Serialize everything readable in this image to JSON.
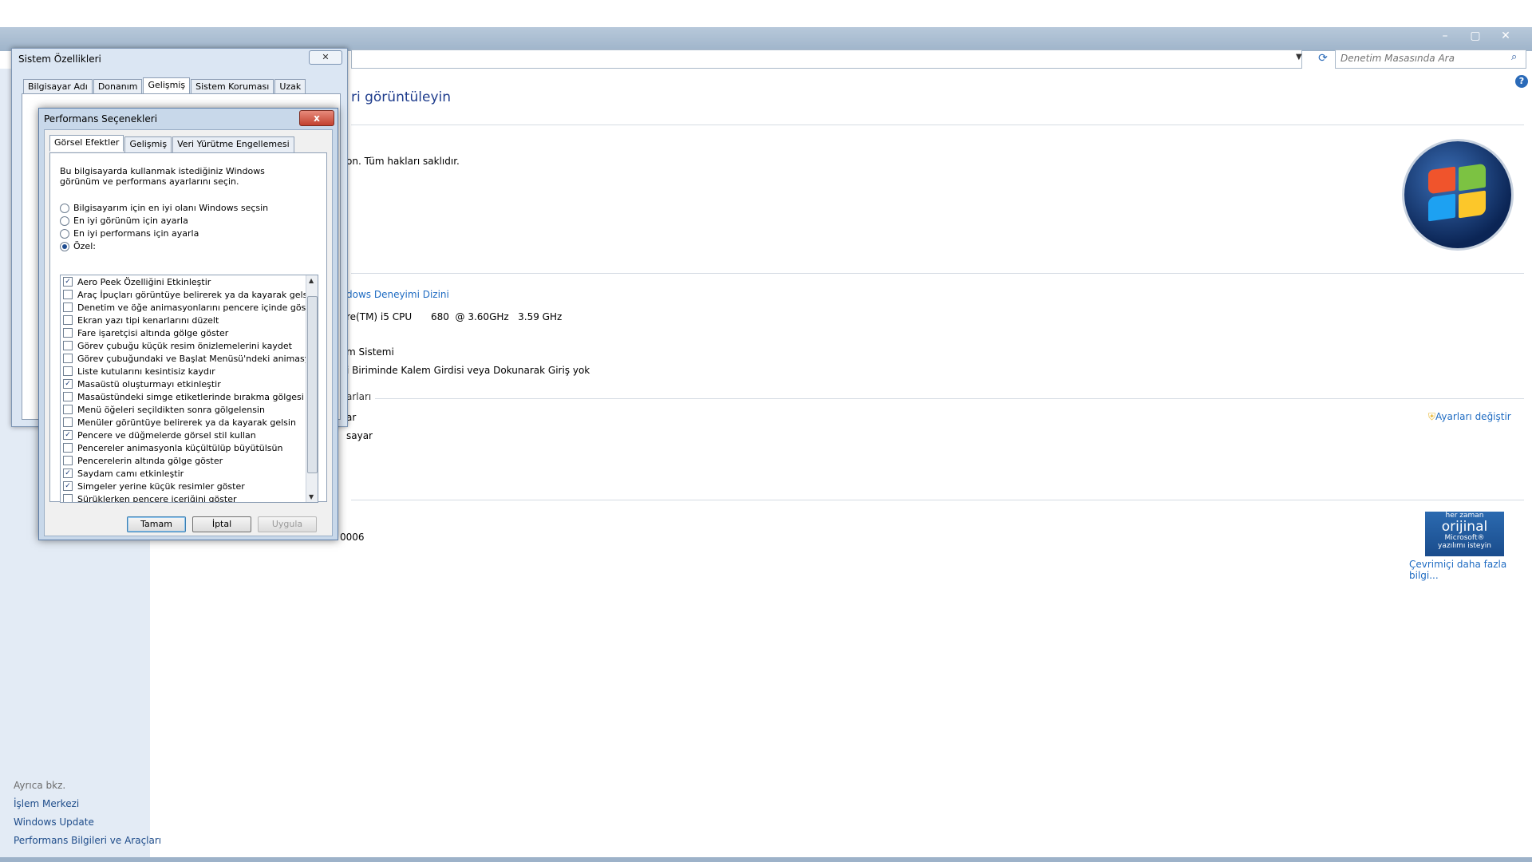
{
  "window": {
    "controls": [
      "–",
      "▢",
      "✕"
    ]
  },
  "search": {
    "placeholder": "Denetim Masasında Ara"
  },
  "main": {
    "heading": "ri görüntüleyin",
    "copyright": "on. Tüm hakları saklıdır.",
    "rating_link": "dows Deneyimi Dizini",
    "processor_label": "re(TM) i5 CPU",
    "processor_value": "680  @ 3.60GHz   3.59 GHz",
    "system_type": "m Sistemi",
    "pen_touch": "i Biriminde Kalem Girdisi veya Dokunarak Giriş yok",
    "section_label": "arları",
    "row1": "ar",
    "row2": "sayar",
    "change_settings": "Ayarları değiştir",
    "product_id": "0006",
    "online_info": "Çevrimiçi daha fazla bilgi...",
    "genuine_top": "her zaman",
    "genuine_big": "orijinal",
    "genuine_ms": "Microsoft®",
    "genuine_bottom": "yazılımı isteyin"
  },
  "sidebar": {
    "see_also": "Ayrıca bkz.",
    "links": [
      "İşlem Merkezi",
      "Windows Update",
      "Performans Bilgileri ve Araçları"
    ]
  },
  "sys_dialog": {
    "title": "Sistem Özellikleri",
    "close": "✕",
    "tabs": [
      "Bilgisayar Adı",
      "Donanım",
      "Gelişmiş",
      "Sistem Koruması",
      "Uzak"
    ]
  },
  "perf_dialog": {
    "title": "Performans Seçenekleri",
    "close": "x",
    "tabs": [
      "Görsel Efektler",
      "Gelişmiş",
      "Veri Yürütme Engellemesi"
    ],
    "description": "Bu bilgisayarda kullanmak istediğiniz Windows görünüm ve performans ayarlarını seçin.",
    "radios": [
      {
        "label": "Bilgisayarım için en iyi olanı Windows seçsin",
        "selected": false
      },
      {
        "label": "En iyi görünüm için ayarla",
        "selected": false
      },
      {
        "label": "En iyi performans için ayarla",
        "selected": false
      },
      {
        "label": "Özel:",
        "selected": true
      }
    ],
    "effects": [
      {
        "label": "Aero Peek Özelliğini Etkinleştir",
        "checked": true
      },
      {
        "label": "Araç İpuçları görüntüye belirerek ya da kayarak gelsin",
        "checked": false
      },
      {
        "label": "Denetim ve öğe animasyonlarını pencere içinde göster",
        "checked": false
      },
      {
        "label": "Ekran yazı tipi kenarlarını düzelt",
        "checked": false
      },
      {
        "label": "Fare işaretçisi altında gölge göster",
        "checked": false
      },
      {
        "label": "Görev çubuğu küçük resim önizlemelerini kaydet",
        "checked": false
      },
      {
        "label": "Görev çubuğundaki ve Başlat Menüsü'ndeki animasyonlar",
        "checked": false
      },
      {
        "label": "Liste kutularını kesintisiz kaydır",
        "checked": false
      },
      {
        "label": "Masaüstü oluşturmayı etkinleştir",
        "checked": true
      },
      {
        "label": "Masaüstündeki simge etiketlerinde bırakma gölgesi kullan",
        "checked": false
      },
      {
        "label": "Menü öğeleri seçildikten sonra gölgelensin",
        "checked": false
      },
      {
        "label": "Menüler görüntüye belirerek ya da kayarak gelsin",
        "checked": false
      },
      {
        "label": "Pencere ve düğmelerde görsel stil kullan",
        "checked": true
      },
      {
        "label": "Pencereler animasyonla küçültülüp büyütülsün",
        "checked": false
      },
      {
        "label": "Pencerelerin altında gölge göster",
        "checked": false
      },
      {
        "label": "Saydam camı etkinleştir",
        "checked": true
      },
      {
        "label": "Simgeler yerine küçük resimler göster",
        "checked": true
      },
      {
        "label": "Sürüklerken pencere içeriğini göster",
        "checked": false
      }
    ],
    "buttons": {
      "ok": "Tamam",
      "cancel": "İptal",
      "apply": "Uygula"
    }
  }
}
